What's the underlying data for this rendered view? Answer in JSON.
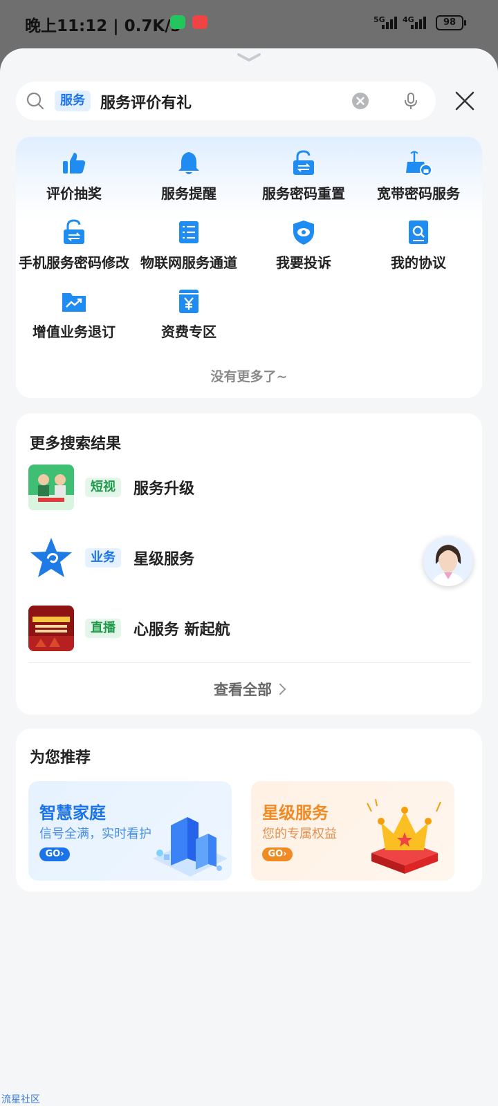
{
  "status_bar": {
    "time_speed": "晚上11:12 | 0.7K/s",
    "signal1": "5G",
    "signal2": "4G",
    "battery": "98"
  },
  "search": {
    "tag": "服务",
    "query": "服务评价有礼"
  },
  "services": [
    {
      "label": "评价抽奖",
      "icon": "thumbs-up-icon"
    },
    {
      "label": "服务提醒",
      "icon": "bell-icon"
    },
    {
      "label": "服务密码重置",
      "icon": "unlock-icon"
    },
    {
      "label": "宽带密码服务",
      "icon": "router-lock-icon"
    },
    {
      "label": "手机服务密码修改",
      "icon": "unlock-icon"
    },
    {
      "label": "物联网服务通道",
      "icon": "list-icon"
    },
    {
      "label": "我要投诉",
      "icon": "shield-eye-icon"
    },
    {
      "label": "我的协议",
      "icon": "document-search-icon"
    },
    {
      "label": "增值业务退订",
      "icon": "folder-chart-icon"
    },
    {
      "label": "资费专区",
      "icon": "yuan-book-icon"
    }
  ],
  "no_more": "没有更多了~",
  "results": {
    "title": "更多搜索结果",
    "items": [
      {
        "badge": "短视",
        "title": "服务升级"
      },
      {
        "badge": "业务",
        "title": "星级服务"
      },
      {
        "badge": "直播",
        "title": "心服务 新起航"
      }
    ],
    "view_all": "查看全部"
  },
  "recommend": {
    "title": "为您推荐",
    "cards": [
      {
        "title": "智慧家庭",
        "subtitle": "信号全满，实时看护",
        "go": "GO"
      },
      {
        "title": "星级服务",
        "subtitle": "您的专属权益",
        "go": "GO"
      }
    ]
  },
  "watermark": "流星社区",
  "colors": {
    "accent": "#1a73e8",
    "icon_blue": "#1e8cf0",
    "orange": "#f08a24"
  }
}
